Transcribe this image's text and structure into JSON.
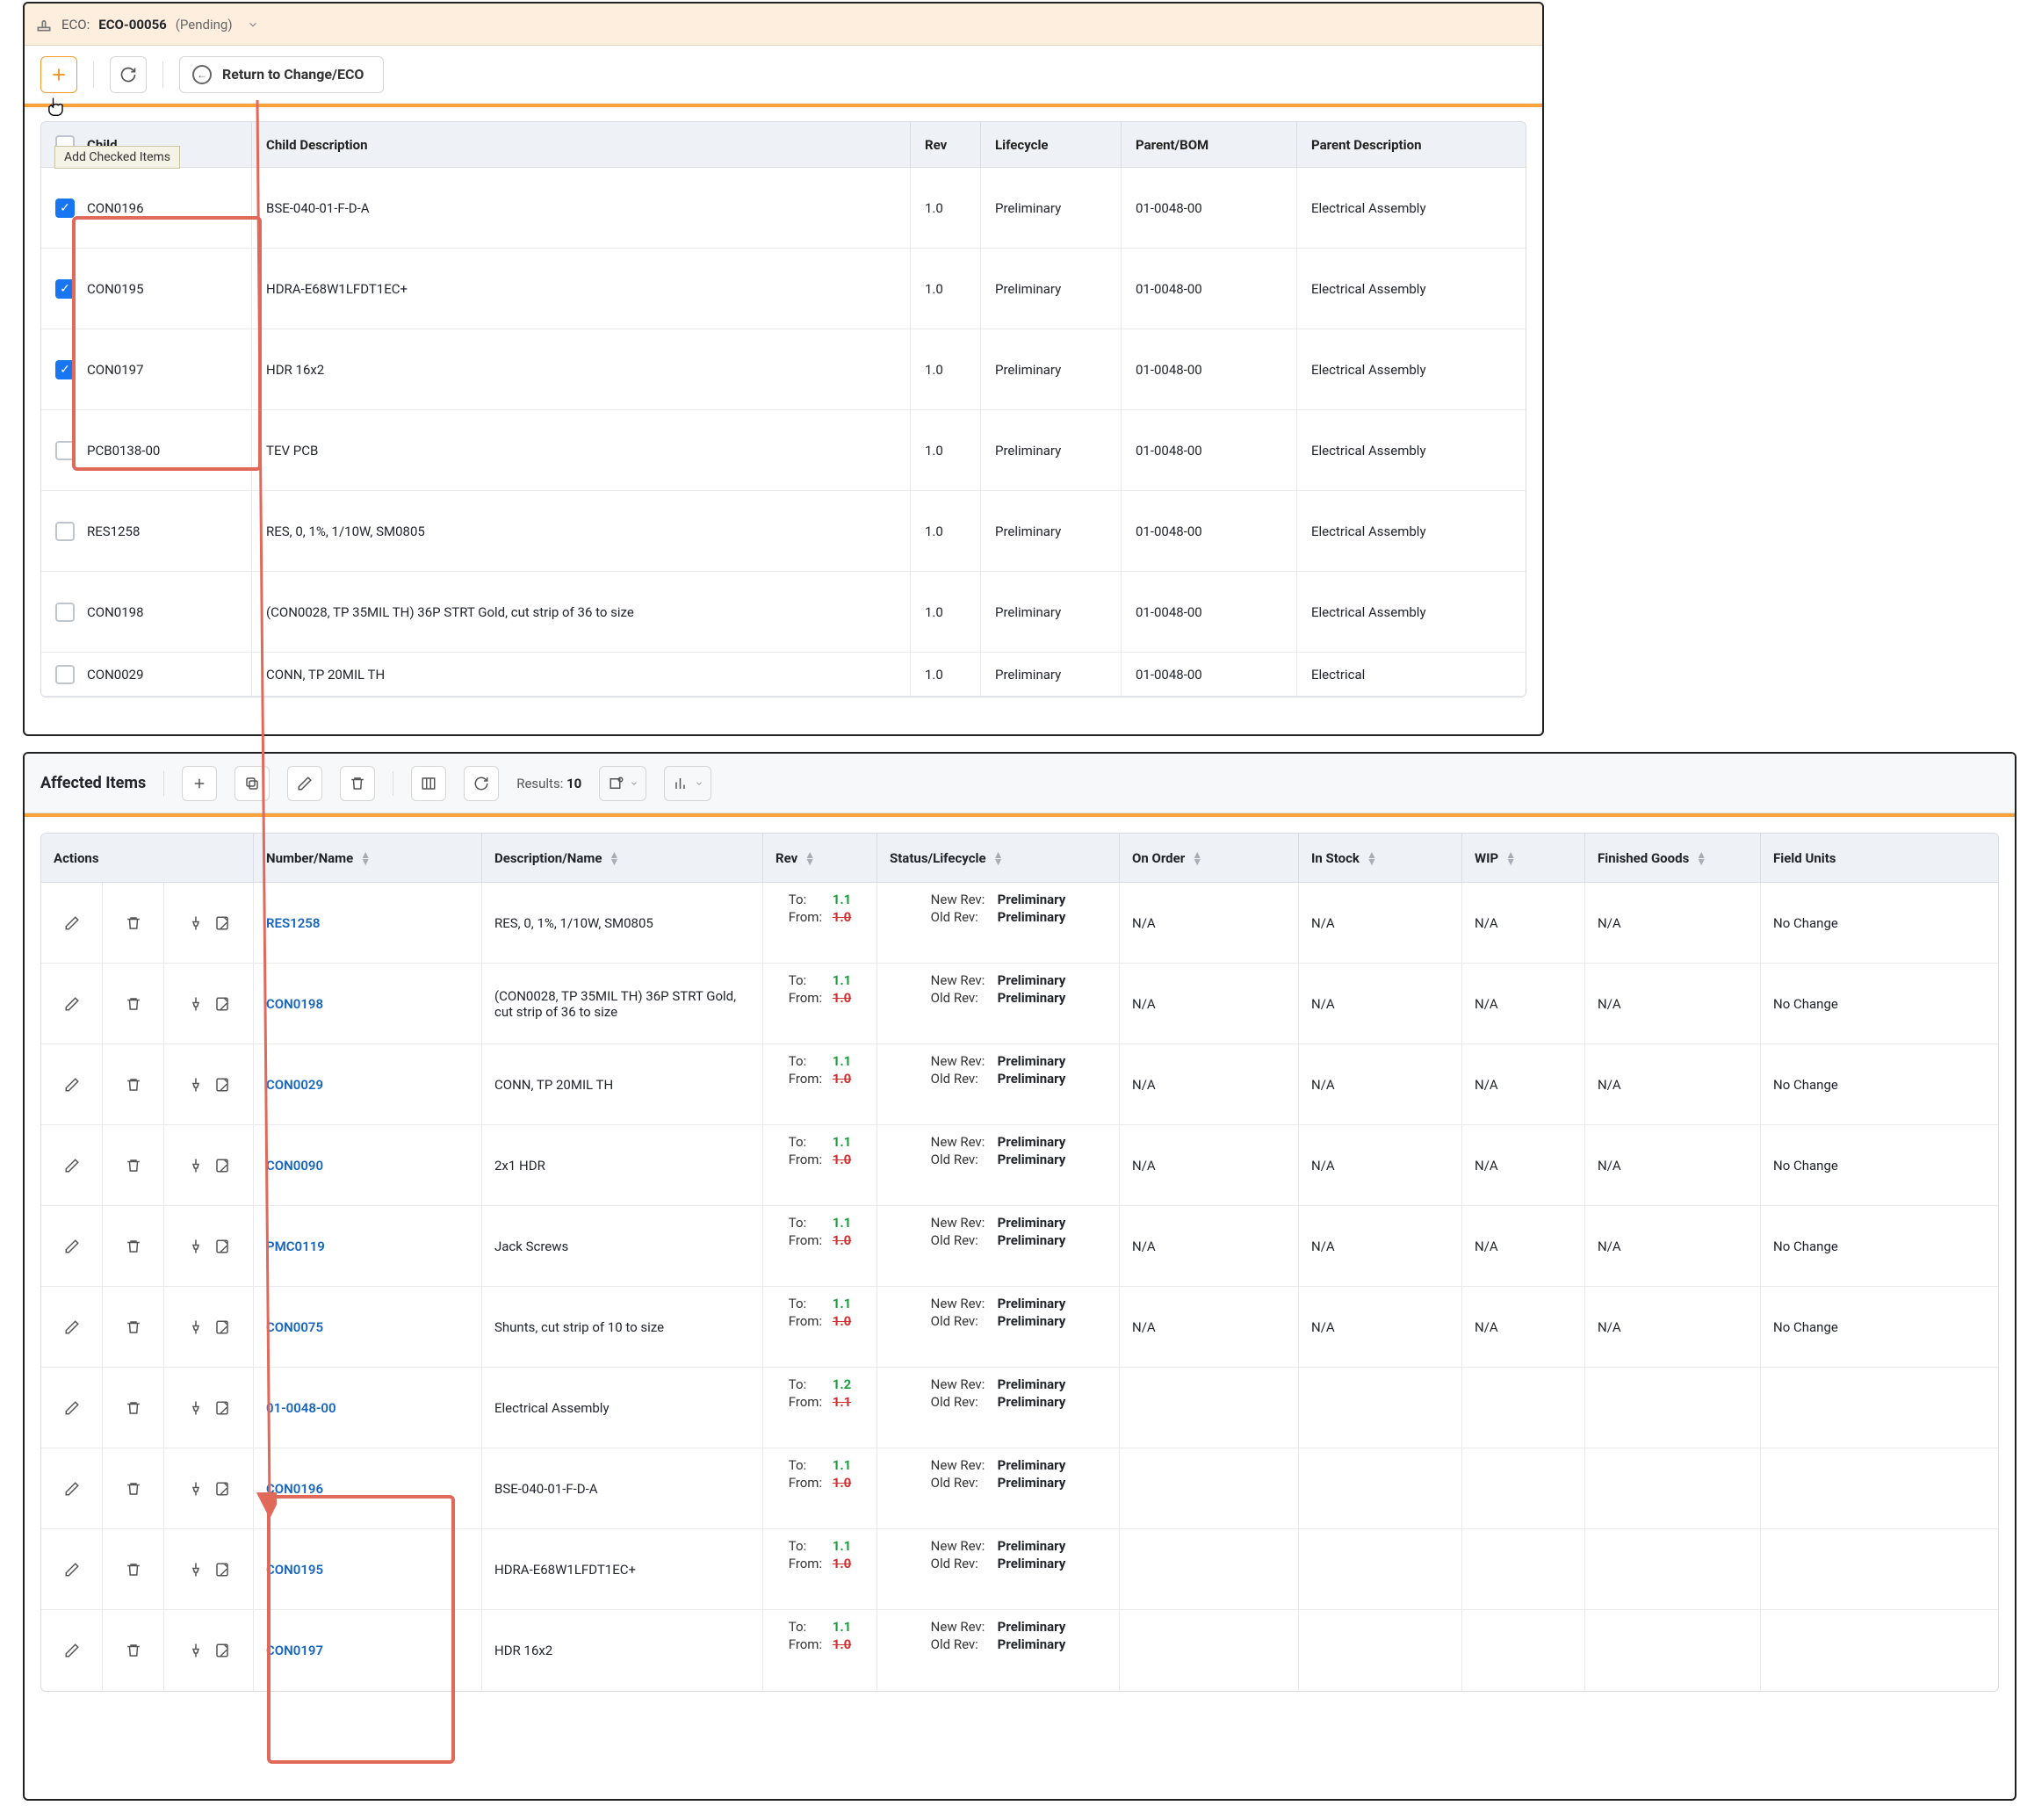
{
  "eco": {
    "label": "ECO:",
    "id": "ECO-00056",
    "status": "(Pending)"
  },
  "toolbar": {
    "tooltip": "Add Checked Items",
    "return_label": "Return to Change/ECO"
  },
  "top_columns": {
    "child": "Child",
    "desc": "Child Description",
    "rev": "Rev",
    "lifecycle": "Lifecycle",
    "parent": "Parent/BOM",
    "pdesc": "Parent Description"
  },
  "top_rows": [
    {
      "checked": true,
      "child": "CON0196",
      "desc": "BSE-040-01-F-D-A",
      "rev": "1.0",
      "lifecycle": "Preliminary",
      "parent": "01-0048-00",
      "pdesc": "Electrical Assembly"
    },
    {
      "checked": true,
      "child": "CON0195",
      "desc": "HDRA-E68W1LFDT1EC+",
      "rev": "1.0",
      "lifecycle": "Preliminary",
      "parent": "01-0048-00",
      "pdesc": "Electrical Assembly"
    },
    {
      "checked": true,
      "child": "CON0197",
      "desc": "HDR 16x2",
      "rev": "1.0",
      "lifecycle": "Preliminary",
      "parent": "01-0048-00",
      "pdesc": "Electrical Assembly"
    },
    {
      "checked": false,
      "child": "PCB0138-00",
      "desc": "TEV PCB",
      "rev": "1.0",
      "lifecycle": "Preliminary",
      "parent": "01-0048-00",
      "pdesc": "Electrical Assembly"
    },
    {
      "checked": false,
      "child": "RES1258",
      "desc": "RES, 0, 1%, 1/10W, SM0805",
      "rev": "1.0",
      "lifecycle": "Preliminary",
      "parent": "01-0048-00",
      "pdesc": "Electrical Assembly"
    },
    {
      "checked": false,
      "child": "CON0198",
      "desc": "(CON0028, TP 35MIL TH) 36P STRT Gold, cut strip of 36 to size",
      "rev": "1.0",
      "lifecycle": "Preliminary",
      "parent": "01-0048-00",
      "pdesc": "Electrical Assembly"
    },
    {
      "checked": false,
      "child": "CON0029",
      "desc": "CONN, TP 20MIL TH",
      "rev": "1.0",
      "lifecycle": "Preliminary",
      "parent": "01-0048-00",
      "pdesc": "Electrical"
    }
  ],
  "affected": {
    "title": "Affected Items",
    "results_label": "Results:",
    "results_count": "10"
  },
  "af_columns": {
    "actions": "Actions",
    "number": "Number/Name",
    "desc": "Description/Name",
    "rev": "Rev",
    "status": "Status/Lifecycle",
    "onorder": "On Order",
    "instock": "In Stock",
    "wip": "WIP",
    "finished": "Finished Goods",
    "field": "Field Units"
  },
  "rev_labels": {
    "to": "To:",
    "from": "From:"
  },
  "status_labels": {
    "new": "New Rev:",
    "old": "Old Rev:"
  },
  "af_rows": [
    {
      "num": "RES1258",
      "desc": "RES, 0, 1%, 1/10W, SM0805",
      "to": "1.1",
      "from": "1.0",
      "new": "Preliminary",
      "old": "Preliminary",
      "onorder": "N/A",
      "instock": "N/A",
      "wip": "N/A",
      "finished": "N/A",
      "field": "No Change"
    },
    {
      "num": "CON0198",
      "desc": "(CON0028, TP 35MIL TH) 36P STRT Gold, cut strip of 36 to size",
      "to": "1.1",
      "from": "1.0",
      "new": "Preliminary",
      "old": "Preliminary",
      "onorder": "N/A",
      "instock": "N/A",
      "wip": "N/A",
      "finished": "N/A",
      "field": "No Change"
    },
    {
      "num": "CON0029",
      "desc": "CONN, TP 20MIL TH",
      "to": "1.1",
      "from": "1.0",
      "new": "Preliminary",
      "old": "Preliminary",
      "onorder": "N/A",
      "instock": "N/A",
      "wip": "N/A",
      "finished": "N/A",
      "field": "No Change"
    },
    {
      "num": "CON0090",
      "desc": "2x1 HDR",
      "to": "1.1",
      "from": "1.0",
      "new": "Preliminary",
      "old": "Preliminary",
      "onorder": "N/A",
      "instock": "N/A",
      "wip": "N/A",
      "finished": "N/A",
      "field": "No Change"
    },
    {
      "num": "PMC0119",
      "desc": "Jack Screws",
      "to": "1.1",
      "from": "1.0",
      "new": "Preliminary",
      "old": "Preliminary",
      "onorder": "N/A",
      "instock": "N/A",
      "wip": "N/A",
      "finished": "N/A",
      "field": "No Change"
    },
    {
      "num": "CON0075",
      "desc": "Shunts, cut strip of 10 to size",
      "to": "1.1",
      "from": "1.0",
      "new": "Preliminary",
      "old": "Preliminary",
      "onorder": "N/A",
      "instock": "N/A",
      "wip": "N/A",
      "finished": "N/A",
      "field": "No Change"
    },
    {
      "num": "01-0048-00",
      "desc": "Electrical Assembly",
      "to": "1.2",
      "from": "1.1",
      "new": "Preliminary",
      "old": "Preliminary",
      "onorder": "",
      "instock": "",
      "wip": "",
      "finished": "",
      "field": ""
    },
    {
      "num": "CON0196",
      "desc": "BSE-040-01-F-D-A",
      "to": "1.1",
      "from": "1.0",
      "new": "Preliminary",
      "old": "Preliminary",
      "onorder": "",
      "instock": "",
      "wip": "",
      "finished": "",
      "field": ""
    },
    {
      "num": "CON0195",
      "desc": "HDRA-E68W1LFDT1EC+",
      "to": "1.1",
      "from": "1.0",
      "new": "Preliminary",
      "old": "Preliminary",
      "onorder": "",
      "instock": "",
      "wip": "",
      "finished": "",
      "field": ""
    },
    {
      "num": "CON0197",
      "desc": "HDR 16x2",
      "to": "1.1",
      "from": "1.0",
      "new": "Preliminary",
      "old": "Preliminary",
      "onorder": "",
      "instock": "",
      "wip": "",
      "finished": "",
      "field": ""
    }
  ]
}
